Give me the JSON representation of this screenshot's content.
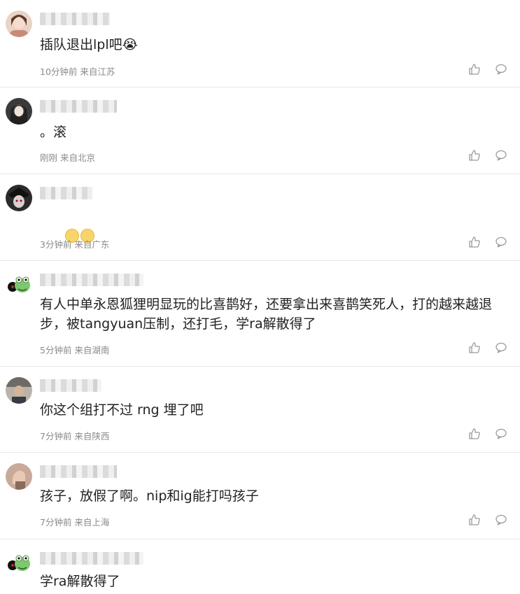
{
  "comments": [
    {
      "text": "插队退出lpl吧😭",
      "meta": "10分钟前 来自江苏",
      "avatar": "woman-avatar"
    },
    {
      "text": "。滚",
      "meta": "刚刚 来自北京",
      "avatar": "girl-dark-avatar"
    },
    {
      "text": "😶😶",
      "meta": "3分钟前 来自广东",
      "avatar": "anime-avatar"
    },
    {
      "text": "有人中单永恩狐狸明显玩的比喜鹊好，还要拿出来喜鹊笑死人，打的越来越退步，被tangyuan压制，还打毛，学ra解散得了",
      "meta": "5分钟前 来自湖南",
      "avatar": "frog-avatar"
    },
    {
      "text": "你这个组打不过 rng 埋了吧",
      "meta": "7分钟前 来自陕西",
      "avatar": "man-avatar"
    },
    {
      "text": "孩子，放假了啊。nip和ig能打吗孩子",
      "meta": "7分钟前 来自上海",
      "avatar": "hand-avatar"
    },
    {
      "text": "学ra解散得了",
      "meta": "",
      "avatar": "frog-avatar"
    }
  ]
}
